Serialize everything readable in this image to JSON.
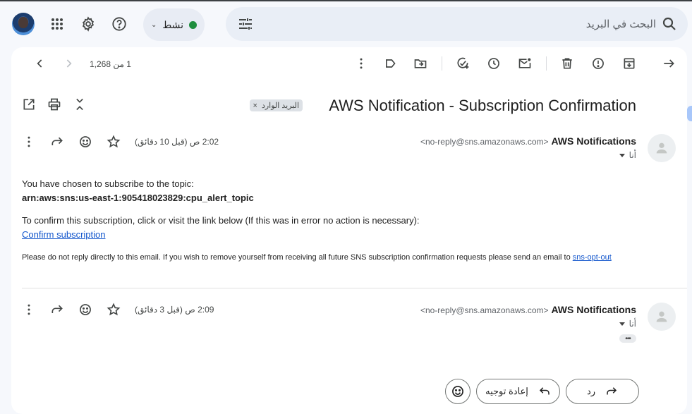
{
  "header": {
    "status_label": "نشط",
    "search_placeholder": "البحث في البريد"
  },
  "toolbar": {
    "pager_text": "1 من 1,268"
  },
  "thread": {
    "subject": "AWS Notification - Subscription Confirmation",
    "label_chip": "البريد الوارد",
    "label_close": "×"
  },
  "messages": [
    {
      "sender_name": "AWS Notifications",
      "sender_email": "<no-reply@sns.amazonaws.com>",
      "to_me": "أنا",
      "time": "2:02 ص (قبل 10 دقائق)",
      "line1": "You have chosen to subscribe to the topic:",
      "topic_arn": "arn:aws:sns:us-east-1:905418023829:cpu_alert_topic",
      "line2": "To confirm this subscription, click or visit the link below (If this was in error no action is necessary):",
      "confirm_link": "Confirm subscription",
      "footer_text": "Please do not reply directly to this email. If you wish to remove yourself from receiving all future SNS subscription confirmation requests please send an email to ",
      "opt_out_link": "sns-opt-out"
    },
    {
      "sender_name": "AWS Notifications",
      "sender_email": "<no-reply@sns.amazonaws.com>",
      "to_me": "أنا",
      "time": "2:09 ص (قبل 3 دقائق)",
      "trimmed_label": "•••"
    }
  ],
  "actions": {
    "reply_label": "رد",
    "forward_label": "إعادة توجيه"
  }
}
